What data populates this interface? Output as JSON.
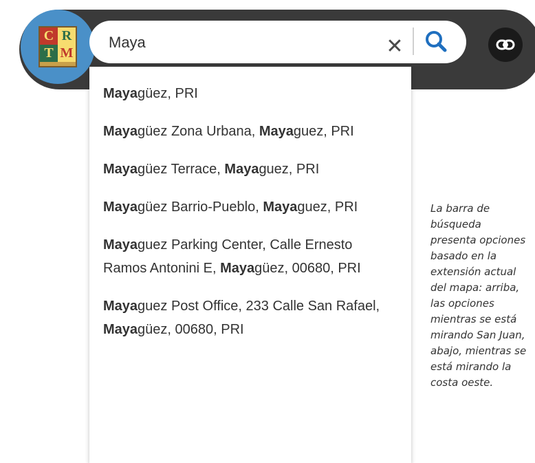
{
  "logo": {
    "letters": [
      "C",
      "R",
      "T",
      "M"
    ]
  },
  "search": {
    "value": "Maya",
    "clear_icon": "close-icon",
    "search_icon": "search-icon",
    "accent_color": "#1f6fbf"
  },
  "share": {
    "icon": "link-icon"
  },
  "suggestions": [
    {
      "parts": [
        {
          "t": "Maya",
          "b": true
        },
        {
          "t": "güez, PRI",
          "b": false
        }
      ]
    },
    {
      "parts": [
        {
          "t": "Maya",
          "b": true
        },
        {
          "t": "güez Zona Urbana, ",
          "b": false
        },
        {
          "t": "Maya",
          "b": true
        },
        {
          "t": "guez, PRI",
          "b": false
        }
      ]
    },
    {
      "parts": [
        {
          "t": "Maya",
          "b": true
        },
        {
          "t": "güez Terrace, ",
          "b": false
        },
        {
          "t": "Maya",
          "b": true
        },
        {
          "t": "guez, PRI",
          "b": false
        }
      ]
    },
    {
      "parts": [
        {
          "t": "Maya",
          "b": true
        },
        {
          "t": "güez Barrio-Pueblo, ",
          "b": false
        },
        {
          "t": "Maya",
          "b": true
        },
        {
          "t": "guez, PRI",
          "b": false
        }
      ]
    },
    {
      "parts": [
        {
          "t": "Maya",
          "b": true
        },
        {
          "t": "guez Parking Center, Calle Ernesto Ramos Antonini E, ",
          "b": false
        },
        {
          "t": "Maya",
          "b": true
        },
        {
          "t": "güez, 00680, PRI",
          "b": false
        }
      ]
    },
    {
      "parts": [
        {
          "t": "Maya",
          "b": true
        },
        {
          "t": "guez Post Office, 233 Calle San Rafael, ",
          "b": false
        },
        {
          "t": "Maya",
          "b": true
        },
        {
          "t": "güez, 00680, PRI",
          "b": false
        }
      ]
    }
  ],
  "caption": "La barra de\nbúsqueda\npresenta opciones\nbasado en la\nextensión actual\ndel mapa: arriba,\nlas opciones\nmientras se está\nmirando San Juan,\nabajo, mientras se\nestá mirando la\ncosta oeste."
}
